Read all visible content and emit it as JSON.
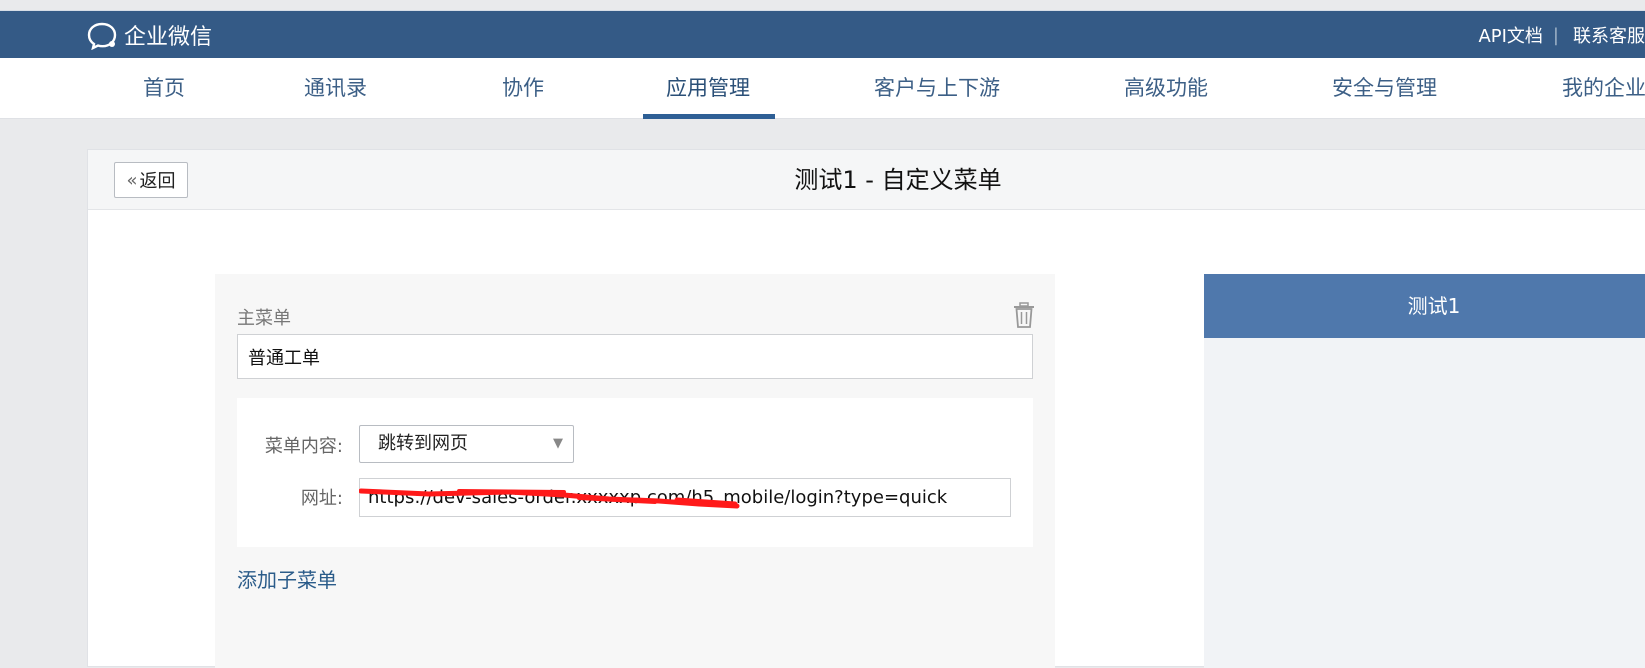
{
  "header": {
    "logo_text": "企业微信",
    "links": [
      "API文档",
      "联系客服"
    ],
    "separator": "|"
  },
  "nav": {
    "items": [
      "首页",
      "通讯录",
      "协作",
      "应用管理",
      "客户与上下游",
      "高级功能",
      "安全与管理",
      "我的企业"
    ],
    "active": "应用管理"
  },
  "panel": {
    "back_label": "返回",
    "back_chevron": "«",
    "title": "测试1 - 自定义菜单"
  },
  "editor": {
    "main_menu_label": "主菜单",
    "main_menu_value": "普通工单",
    "content_label": "菜单内容:",
    "content_selected": "跳转到网页",
    "caret": "▼",
    "url_label": "网址:",
    "url_value": "https://dev-sales-order.xxxxxp.com/h5_mobile/login?type=quick",
    "add_submenu": "添加子菜单",
    "delete_icon": "trash-icon"
  },
  "preview": {
    "title": "测试1"
  },
  "colors": {
    "topbar": "#345a86",
    "nav_text": "#3c5f86",
    "active_underline": "#2e5f95",
    "preview_header": "#4f78ac",
    "redaction": "#ff1a1a"
  }
}
